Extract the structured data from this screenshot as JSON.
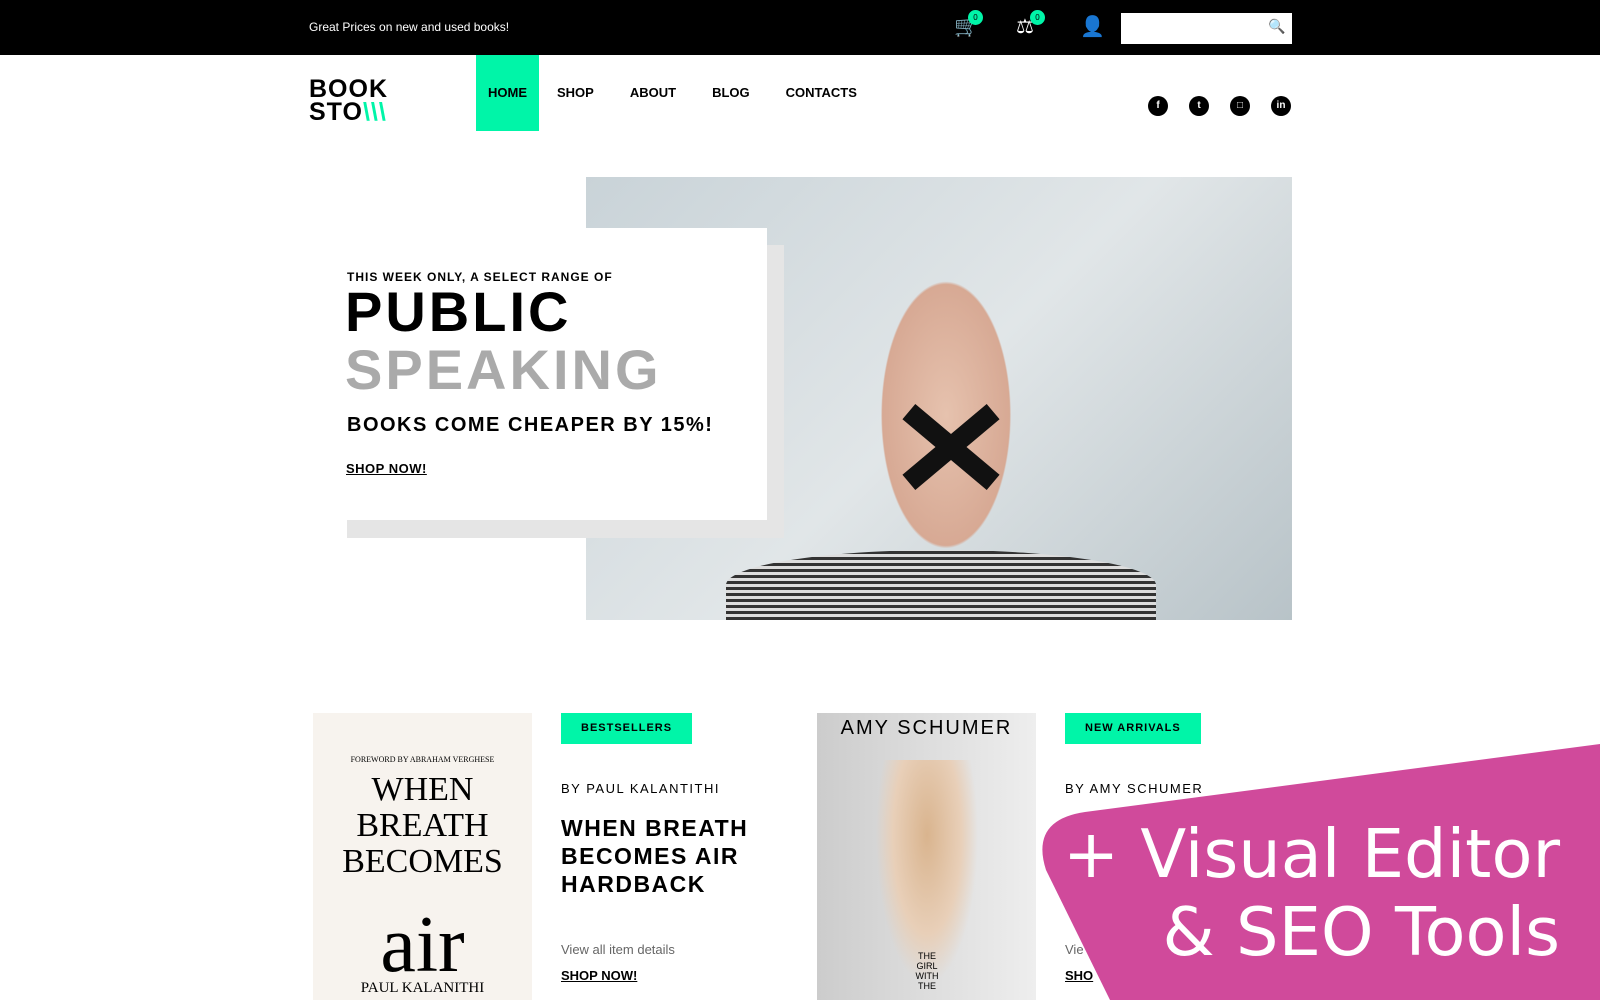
{
  "topbar": {
    "promo": "Great Prices on new and used books!",
    "cart_count": "0",
    "compare_count": "0",
    "search_placeholder": ""
  },
  "logo": {
    "line1": "BOOK",
    "line2": "STO"
  },
  "nav": [
    "HOME",
    "SHOP",
    "ABOUT",
    "BLOG",
    "CONTACTS"
  ],
  "social": [
    "facebook",
    "twitter",
    "instagram",
    "linkedin"
  ],
  "hero": {
    "kicker": "THIS WEEK ONLY, A SELECT RANGE OF",
    "title1": "PUBLIC",
    "title2": "SPEAKING",
    "subtitle": "BOOKS COME CHEAPER BY 15%!",
    "cta": "SHOP NOW!"
  },
  "products": [
    {
      "tag": "BESTSELLERS",
      "author": "BY PAUL KALANTITHI",
      "title": "WHEN BREATH BECOMES AIR HARDBACK",
      "view": "View all item details",
      "cta": "SHOP NOW!",
      "cover": {
        "foreword": "FOREWORD BY ABRAHAM VERGHESE",
        "title": "WHEN BREATH BECOMES",
        "big": "air",
        "author": "PAUL KALANITHI"
      }
    },
    {
      "tag": "NEW ARRIVALS",
      "author": "BY AMY SCHUMER",
      "view": "Vie",
      "cta": "SHO",
      "cover": {
        "author": "AMY SCHUMER",
        "title": "THE GIRL WITH THE"
      }
    }
  ],
  "banner": {
    "line1": "+ Visual Editor",
    "line2": "& SEO Tools",
    "color": "#d04a9b"
  },
  "colors": {
    "accent": "#00f5a8"
  }
}
